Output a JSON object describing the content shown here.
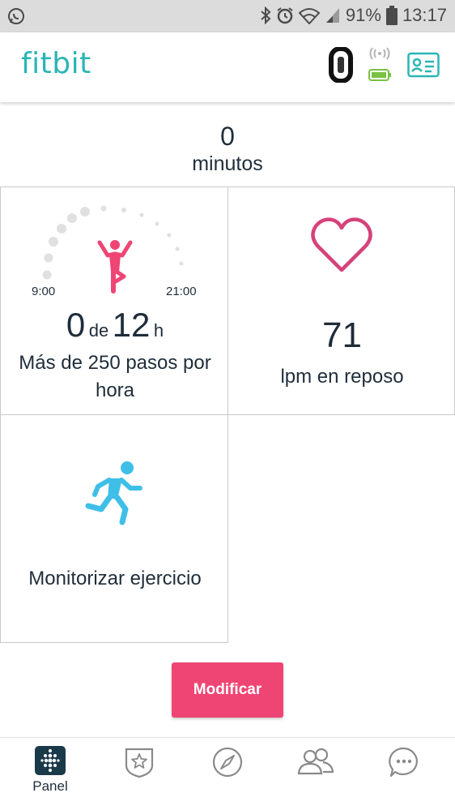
{
  "status_bar": {
    "battery_percent": "91%",
    "time": "13:17",
    "icons": [
      "whatsapp-icon",
      "bluetooth-icon",
      "alarm-icon",
      "wifi-icon",
      "signal-icon",
      "battery-icon"
    ]
  },
  "header": {
    "logo": "fitbit",
    "icons": [
      "tracker-icon",
      "sync-icon",
      "profile-card-icon"
    ]
  },
  "active_minutes": {
    "value": "0",
    "label": "minutos"
  },
  "hourly_tile": {
    "time_start": "9:00",
    "time_end": "21:00",
    "current": "0",
    "connector": "de",
    "goal": "12",
    "unit": "h",
    "description": "Más de 250 pasos por hora"
  },
  "heart_tile": {
    "value": "71",
    "label": "lpm en reposo"
  },
  "exercise_tile": {
    "label": "Monitorizar ejercicio"
  },
  "edit_button": {
    "label": "Modificar"
  },
  "bottom_nav": {
    "items": [
      {
        "label": "Panel",
        "icon": "dashboard-icon"
      },
      {
        "label": "",
        "icon": "challenges-icon"
      },
      {
        "label": "",
        "icon": "discover-icon"
      },
      {
        "label": "",
        "icon": "community-icon"
      },
      {
        "label": "",
        "icon": "more-icon"
      }
    ]
  },
  "colors": {
    "brand": "#2bb5b5",
    "pink": "#ef4575",
    "heart": "#d6427a",
    "runner": "#3fbfe8",
    "battery_green": "#7bc142",
    "dark_text": "#1f2d3a"
  }
}
